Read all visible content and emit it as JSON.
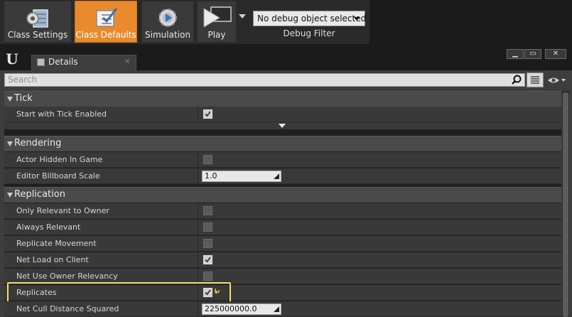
{
  "toolbar": {
    "buttons": [
      {
        "label": "Class Settings",
        "icon": "gear-grid-icon",
        "active": false
      },
      {
        "label": "Class Defaults",
        "icon": "checklist-icon",
        "active": true
      },
      {
        "label": "Simulation",
        "icon": "simulate-gear-icon",
        "active": false
      },
      {
        "label": "Play",
        "icon": "play-icon",
        "active": false
      }
    ],
    "debug_object": "No debug object selected",
    "debug_filter_label": "Debug Filter"
  },
  "panel": {
    "tab_label": "Details",
    "tab_close": "×",
    "window_buttons": {
      "minimize": "▁",
      "maximize": "▭",
      "close": "✕"
    },
    "search_placeholder": "Search"
  },
  "categories": [
    {
      "name": "Tick",
      "props": [
        {
          "label": "Start with Tick Enabled",
          "type": "checkbox",
          "checked": true
        }
      ]
    },
    {
      "name": "Rendering",
      "props": [
        {
          "label": "Actor Hidden In Game",
          "type": "checkbox",
          "checked": false
        },
        {
          "label": "Editor Billboard Scale",
          "type": "number",
          "value": "1.0"
        }
      ]
    },
    {
      "name": "Replication",
      "props": [
        {
          "label": "Only Relevant to Owner",
          "type": "checkbox",
          "checked": false
        },
        {
          "label": "Always Relevant",
          "type": "checkbox",
          "checked": false
        },
        {
          "label": "Replicate Movement",
          "type": "checkbox",
          "checked": false
        },
        {
          "label": "Net Load on Client",
          "type": "checkbox",
          "checked": true
        },
        {
          "label": "Net Use Owner Relevancy",
          "type": "checkbox",
          "checked": false
        },
        {
          "label": "Replicates",
          "type": "checkbox",
          "checked": true,
          "highlighted": true,
          "reset_to_default": true
        },
        {
          "label": "Net Cull Distance Squared",
          "type": "number",
          "value": "225000000.0"
        }
      ]
    }
  ],
  "colors": {
    "accent": "#e98a2c",
    "highlight": "#f3e05a"
  }
}
